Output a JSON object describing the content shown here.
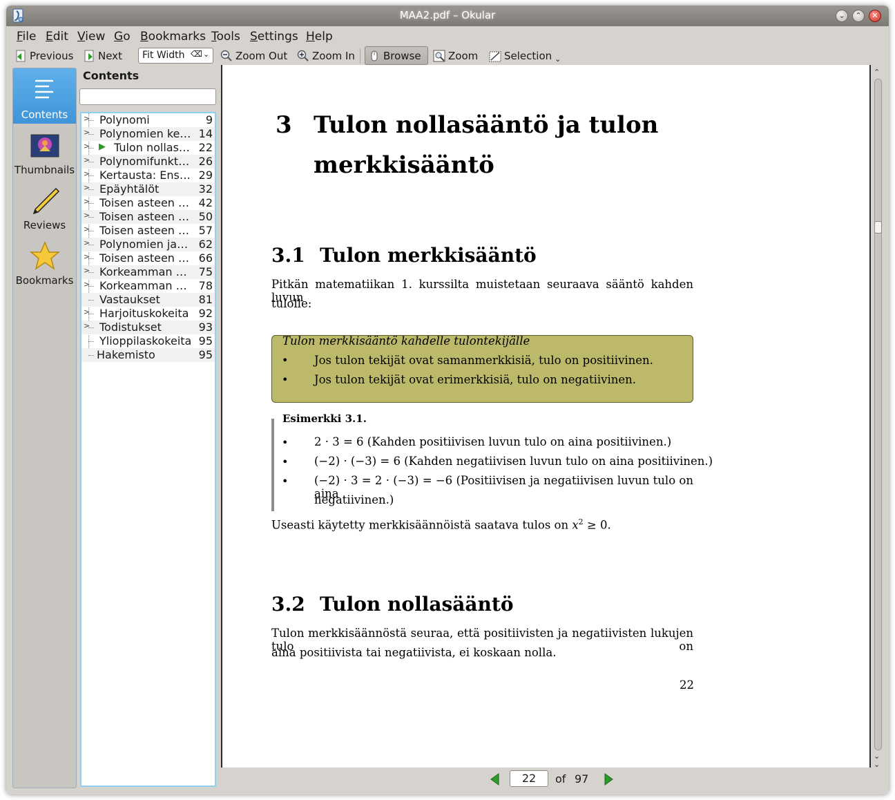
{
  "window": {
    "title": "MAA2.pdf – Okular"
  },
  "menu": [
    "File",
    "Edit",
    "View",
    "Go",
    "Bookmarks",
    "Tools",
    "Settings",
    "Help"
  ],
  "toolbar": {
    "previous": "Previous",
    "next": "Next",
    "zoom_mode": "Fit Width",
    "zoom_out": "Zoom Out",
    "zoom_in": "Zoom In",
    "browse": "Browse",
    "zoom": "Zoom",
    "selection": "Selection"
  },
  "sidebar": {
    "items": [
      {
        "label": "Contents",
        "icon": "contents-icon"
      },
      {
        "label": "Thumbnails",
        "icon": "thumbnails-icon"
      },
      {
        "label": "Reviews",
        "icon": "reviews-icon"
      },
      {
        "label": "Bookmarks",
        "icon": "bookmarks-icon"
      }
    ]
  },
  "contents": {
    "title": "Contents",
    "search_value": "",
    "toc": [
      {
        "title": "Polynomi",
        "page": "9"
      },
      {
        "title": "Polynomien ke…",
        "page": "14"
      },
      {
        "title": "Tulon nollas…",
        "page": "22"
      },
      {
        "title": "Polynomifunkti…",
        "page": "26"
      },
      {
        "title": "Kertausta: Ensi…",
        "page": "29"
      },
      {
        "title": "Epäyhtälöt",
        "page": "32"
      },
      {
        "title": "Toisen asteen …",
        "page": "42"
      },
      {
        "title": "Toisen asteen …",
        "page": "50"
      },
      {
        "title": "Toisen asteen …",
        "page": "57"
      },
      {
        "title": "Polynomien jak…",
        "page": "62"
      },
      {
        "title": "Toisen asteen …",
        "page": "66"
      },
      {
        "title": "Korkeamman a…",
        "page": "75"
      },
      {
        "title": "Korkeamman a…",
        "page": "78"
      },
      {
        "title": "Vastaukset",
        "page": "81"
      },
      {
        "title": "Harjoituskokeita",
        "page": "92"
      },
      {
        "title": "Todistukset",
        "page": "93"
      },
      {
        "title": "Ylioppilaskokeita",
        "page": "95"
      },
      {
        "title": "Hakemisto",
        "page": "95"
      }
    ]
  },
  "document": {
    "chapter_number": "3",
    "chapter_title_line1": "Tulon nollasääntö ja tulon",
    "chapter_title_line2": "merkkisääntö",
    "section1_number": "3.1",
    "section1_title": "Tulon merkkisääntö",
    "para1_line1": "Pitkän matematiikan 1. kurssilta muistetaan seuraava sääntö kahden luvun",
    "para1_line2": "tulolle:",
    "theorem_title": "Tulon merkkisääntö kahdelle tulontekijälle",
    "theorem_items": [
      "Jos tulon tekijät ovat samanmerkkisiä, tulo on positiivinen.",
      "Jos tulon tekijät ovat erimerkkisiä, tulo on negatiivinen."
    ],
    "example_title": "Esimerkki 3.1.",
    "example_items": [
      "2 · 3 = 6 (Kahden positiivisen luvun tulo on aina positiivinen.)",
      "(−2) · (−3) = 6 (Kahden negatiivisen luvun tulo on aina positiivinen.)",
      "(−2) · 3 = 2 · (−3) = −6 (Positiivisen ja negatiivisen luvun tulo on aina",
      "negatiivinen.)"
    ],
    "para2_prefix": "Useasti käytetty merkkisäännöistä saatava tulos on ",
    "para2_var": "x",
    "para2_exp": "2",
    "para2_suffix": " ≥ 0.",
    "section2_number": "3.2",
    "section2_title": "Tulon nollasääntö",
    "para3_line1": "Tulon merkkisäännöstä seuraa, että positiivisten ja negatiivisten lukujen tulo on",
    "para3_line2": "aina positiivista tai negatiivista, ei koskaan nolla.",
    "page_number": "22"
  },
  "pagebar": {
    "current_page": "22",
    "of_label": "of",
    "total_pages": "97"
  },
  "colors": {
    "active_sidebar": "#3f95d8",
    "theorem_box": "#bdb96a",
    "nav_arrow": "#2c9a2c"
  }
}
